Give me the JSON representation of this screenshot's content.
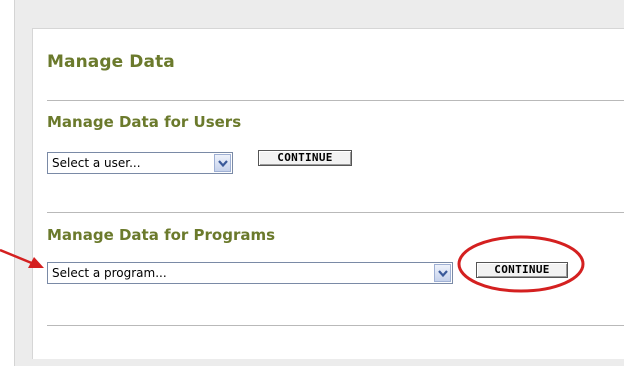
{
  "page": {
    "title": "Manage Data"
  },
  "users_section": {
    "heading": "Manage Data for Users",
    "select_value": "Select a user...",
    "continue_label": "CONTINUE"
  },
  "programs_section": {
    "heading": "Manage Data for Programs",
    "select_value": "Select a program...",
    "continue_label": "CONTINUE"
  },
  "annotations": {
    "highlight_color": "#d42020",
    "arrow_color": "#d42020",
    "arrow_target": "programs-select",
    "circle_target": "programs-continue-button"
  },
  "theme": {
    "heading_color": "#6b7a2c",
    "frame_color": "#ececec"
  }
}
